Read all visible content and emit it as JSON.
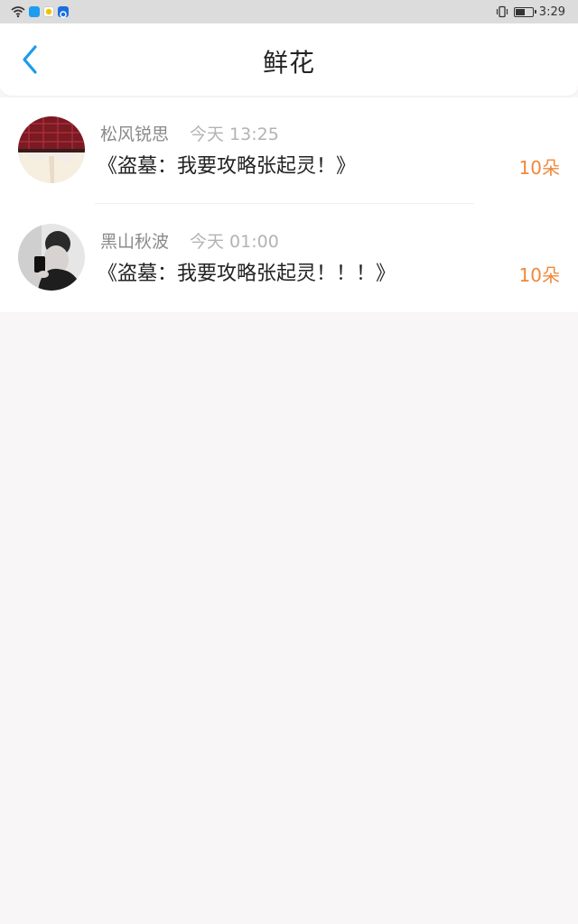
{
  "status_bar": {
    "time": "3:29",
    "icons": [
      "wifi-icon",
      "app-blue-icon",
      "app-yellow-icon",
      "app-shield-icon",
      "vibrate-icon",
      "battery-icon"
    ],
    "colors": {
      "app_blue": "#1e9cf0",
      "app_yellow": "#f2c200",
      "app_shield": "#1a6fe0"
    }
  },
  "header": {
    "title": "鲜花",
    "back_icon": "chevron-left-icon",
    "accent_color": "#1a9bef"
  },
  "flowers": [
    {
      "user": "松风锐思",
      "time": "今天 13:25",
      "book": "《盗墓：我要攻略张起灵！》",
      "count": "10朵"
    },
    {
      "user": "黑山秋波",
      "time": "今天 01:00",
      "book": "《盗墓：我要攻略张起灵！！！》",
      "count": "10朵"
    }
  ],
  "colors": {
    "count": "#f0883a",
    "username": "#8a8a8a",
    "time": "#b3b3b3"
  }
}
